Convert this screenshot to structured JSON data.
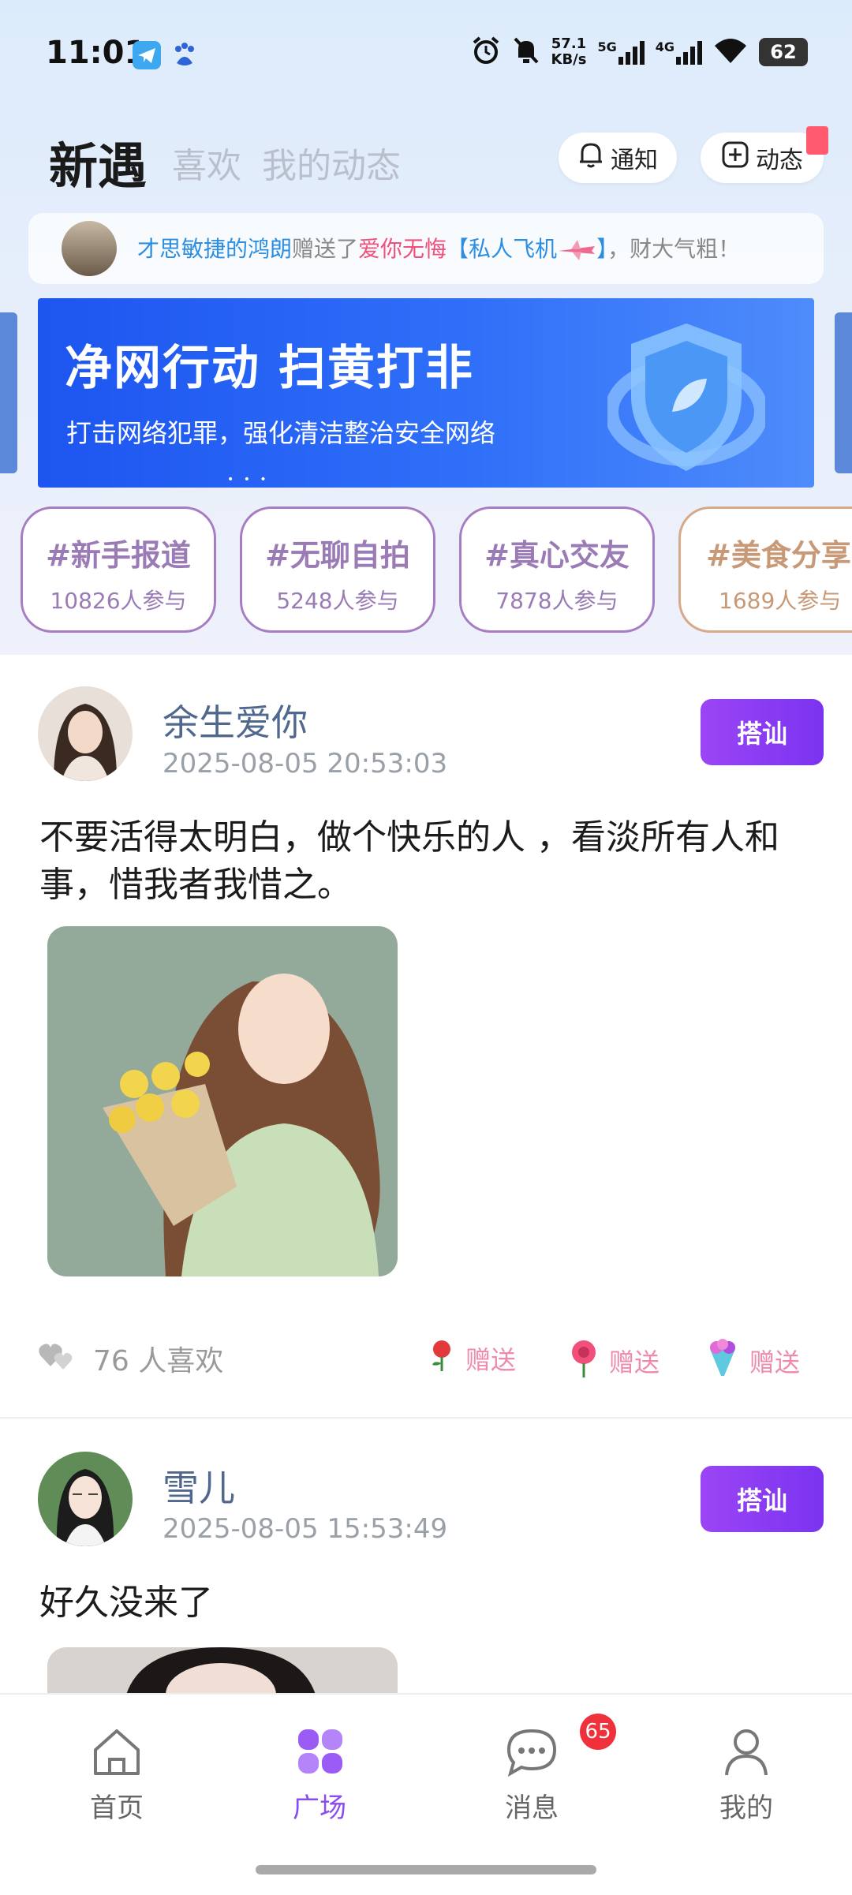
{
  "status_bar": {
    "time": "11:01",
    "net_speed_value": "57.1",
    "net_speed_unit": "KB/s",
    "net1": "5G",
    "net2": "4G",
    "battery": "62",
    "icons": [
      "telegram-icon",
      "baidu-icon",
      "alarm-icon",
      "mute-icon",
      "signal-icon",
      "wifi-icon",
      "battery-icon"
    ]
  },
  "header": {
    "title": "新遇",
    "tabs": [
      "喜欢",
      "我的动态"
    ],
    "notify_label": "通知",
    "post_label": "动态"
  },
  "ticker": {
    "user": "才思敏捷的鸿朗",
    "action": "赠送了",
    "target": "爱你无悔",
    "gift": "【私人飞机",
    "gift_end": "】",
    "suffix": "，财大气粗！"
  },
  "banner": {
    "title": "净网行动  扫黄打非",
    "subtitle": "打击网络犯罪，强化清洁整治安全网络"
  },
  "topics": [
    {
      "name": "#新手报道",
      "count": "10826人参与"
    },
    {
      "name": "#无聊自拍",
      "count": "5248人参与"
    },
    {
      "name": "#真心交友",
      "count": "7878人参与"
    },
    {
      "name": "#美食分享",
      "count": "1689人参与"
    }
  ],
  "posts": [
    {
      "username": "余生爱你",
      "time": "2025-08-05 20:53:03",
      "button": "搭讪",
      "text": "不要活得太明白，做个快乐的人 ，看淡所有人和事，惜我者我惜之。",
      "likes": "76 人喜欢",
      "gifts": [
        "赠送",
        "赠送",
        "赠送"
      ]
    },
    {
      "username": "雪儿",
      "time": "2025-08-05 15:53:49",
      "button": "搭讪",
      "text": "好久没来了"
    }
  ],
  "nav": {
    "items": [
      "首页",
      "广场",
      "消息",
      "我的"
    ],
    "active": "广场",
    "message_badge": "65"
  },
  "colors": {
    "accent_purple": "#8a4cf0",
    "banner_blue": "#1d55f0",
    "username_blue": "#50688e",
    "gift_pink": "#ee8bab",
    "badge_red": "#f0313b"
  }
}
